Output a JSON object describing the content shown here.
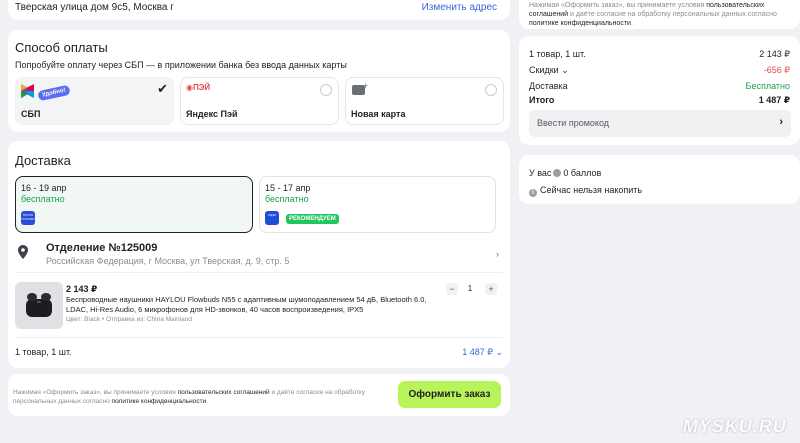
{
  "address": {
    "text": "Тверская улица дом 9с5, Москва г",
    "change_label": "Изменить адрес"
  },
  "payment": {
    "title": "Способ оплаты",
    "subtitle": "Попробуйте оплату через СБП — в приложении банка без ввода данных карты",
    "methods": [
      {
        "label": "СБП",
        "badge": "Удобно!",
        "selected": true,
        "icon": "sbp-logo-icon"
      },
      {
        "label": "Яндекс Пэй",
        "logo_text": "ПЭЙ",
        "selected": false,
        "icon": "yandex-pay-icon"
      },
      {
        "label": "Новая карта",
        "selected": false,
        "icon": "add-card-icon"
      }
    ]
  },
  "delivery": {
    "title": "Доставка",
    "options": [
      {
        "dates": "16 - 19 апр",
        "price": "бесплатно",
        "carrier": "ПОЧТА РОССИИ",
        "selected": true
      },
      {
        "dates": "15 - 17 апр",
        "price": "бесплатно",
        "carrier": "СДЭК",
        "badge": "РЕКОМЕНДУЕМ",
        "selected": false
      }
    ],
    "branch": {
      "title": "Отделение №125009",
      "address": "Российская Федерация, г Москва, ул Тверская, д. 9, стр. 5"
    },
    "product": {
      "price": "2 143 ₽",
      "name": "Беспроводные наушники HAYLOU Flowbuds N55 с адаптивным шумоподавлением 54 дБ, Bluetooth 6.0, LDAC, Hi-Res Audio, 6 микрофонов для HD-звонков, 40 часов воспроизведения, IPX5",
      "meta": "Цвет: Black • Отправка из: China Mainland",
      "quantity": "1",
      "minus": "−",
      "plus": "+"
    },
    "summary": {
      "left": "1 товар, 1 шт.",
      "right": "1 487 ₽"
    }
  },
  "footer": {
    "terms_prefix": "Нажимая «Оформить заказ», вы принимаете условия ",
    "terms_link1": "пользовательских соглашений",
    "terms_middle": " и даёте согласие на обработку персональных данных согласно ",
    "terms_link2": "политике конфиденциальности",
    "terms_suffix": ".",
    "order_button": "Оформить заказ"
  },
  "sidebar": {
    "terms_prefix": "Нажимая «Оформить заказ», вы принимаете условия ",
    "terms_link1": "пользовательских соглашений",
    "terms_middle": " и даёте согласие на обработку персональных данных согласно ",
    "terms_link2": "политике конфиденциальности",
    "terms_suffix": ".",
    "items_label": "1 товар, 1 шт.",
    "items_value": "2 143 ₽",
    "discount_label": "Скидки",
    "discount_value": "-656 ₽",
    "delivery_label": "Доставка",
    "delivery_value": "Бесплатно",
    "total_label": "Итого",
    "total_value": "1 487 ₽",
    "promo_label": "Ввести промокод",
    "balance_prefix": "У вас",
    "balance_value": "0 баллов",
    "accrual_note": "Сейчас нельзя накопить"
  },
  "colors": {
    "accent_button": "#b8f35a",
    "link": "#3d67d9",
    "free": "#16a34a",
    "discount": "#e5484d",
    "recommend_badge": "#22c55e"
  },
  "watermark": "MYSKU.RU"
}
